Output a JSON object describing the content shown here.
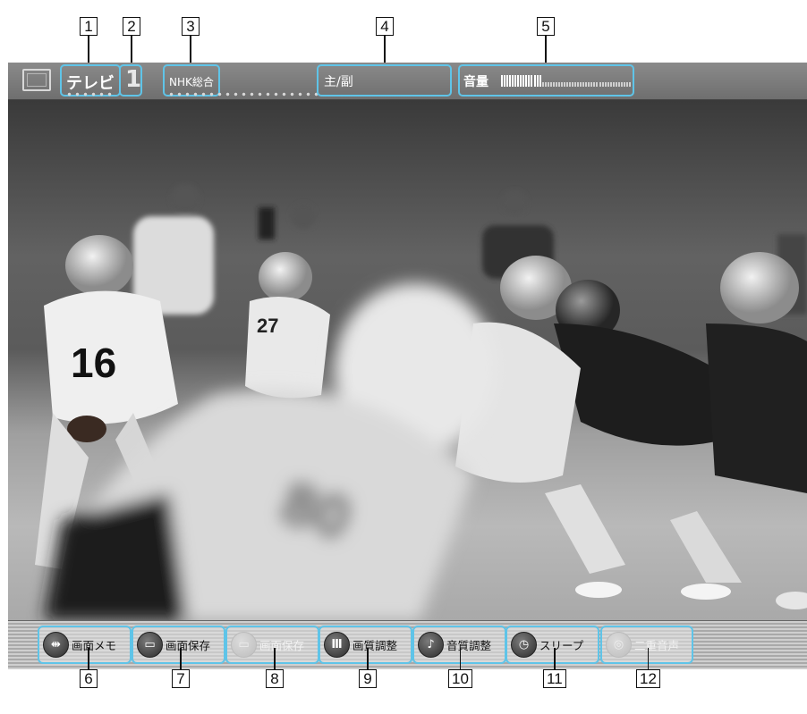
{
  "callouts": {
    "top": [
      "1",
      "2",
      "3",
      "4",
      "5"
    ],
    "bottom": [
      "6",
      "7",
      "8",
      "9",
      "10",
      "11",
      "12"
    ]
  },
  "status_bar": {
    "mode_label": "テレビ",
    "channel_number": "1",
    "station_name": "NHK総合",
    "audio_mode": "主/副",
    "volume_label": "音量",
    "volume_level": 0.3
  },
  "menu": [
    {
      "label": "画面メモ",
      "icon": "memo-icon",
      "glyph": "⇹",
      "enabled": true
    },
    {
      "label": "画面保存",
      "icon": "save-screen-icon",
      "glyph": "▭",
      "enabled": true
    },
    {
      "label": "画面保存",
      "icon": "save-screen-disabled-icon",
      "glyph": "▭",
      "enabled": false
    },
    {
      "label": "画質調整",
      "icon": "picture-quality-icon",
      "glyph": "Ⅲ",
      "enabled": true
    },
    {
      "label": "音質調整",
      "icon": "sound-quality-icon",
      "glyph": "♪",
      "enabled": true
    },
    {
      "label": "スリープ",
      "icon": "sleep-timer-icon",
      "glyph": "◷",
      "enabled": true
    },
    {
      "label": "二重音声",
      "icon": "dual-audio-icon",
      "glyph": "◎",
      "enabled": false
    }
  ],
  "colors": {
    "highlight": "#5fc4e8",
    "bar_background": "#7a7a7a"
  }
}
